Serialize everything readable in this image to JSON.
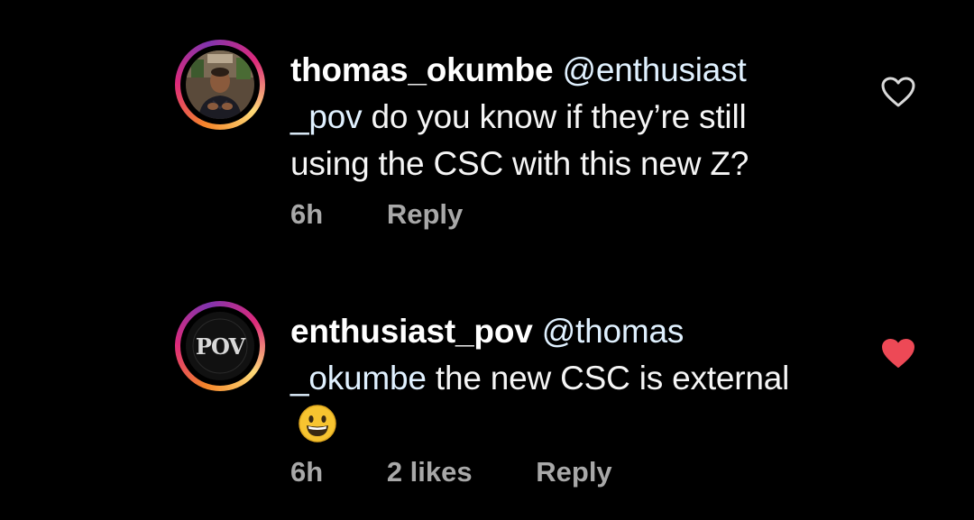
{
  "comments": [
    {
      "username": "thomas_okumbe",
      "mention_part1": "@enthusiast",
      "mention_part2": "_pov",
      "text": " do you know if they’re still using the CSC with this new Z?",
      "time": "6h",
      "likes": "",
      "reply_label": "Reply",
      "liked": false,
      "avatar": "person-photo"
    },
    {
      "username": "enthusiast_pov",
      "mention_part1": "@thomas",
      "mention_part2": "_okumbe",
      "text": " the new CSC is external",
      "emoji": "grinning-face-emoji",
      "time": "6h",
      "likes": "2 likes",
      "reply_label": "Reply",
      "liked": true,
      "avatar": "pov-logo"
    }
  ],
  "avatar_logo_text": "POV",
  "colors": {
    "background": "#000000",
    "text": "#f5f5f5",
    "mention": "#e0f1ff",
    "meta": "#a8a8a8",
    "liked_heart": "#ed4956",
    "heart_outline": "#d9d9d9"
  },
  "icons": [
    "heart-outline-icon",
    "heart-filled-icon"
  ]
}
